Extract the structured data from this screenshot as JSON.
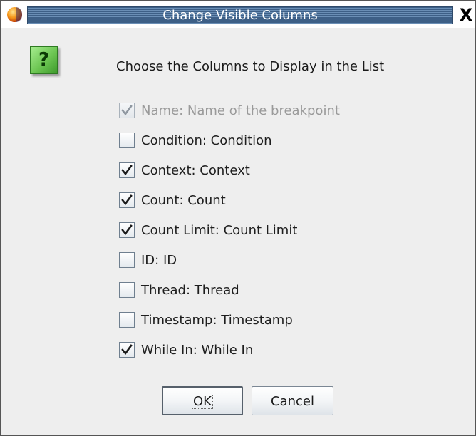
{
  "window": {
    "title": "Change Visible Columns",
    "close_glyph": "X",
    "app_icon": "java-cup-icon"
  },
  "dialog": {
    "help_icon_glyph": "?",
    "prompt": "Choose the Columns to Display in the List",
    "columns": [
      {
        "label": "Name: Name of the breakpoint",
        "checked": true,
        "enabled": false
      },
      {
        "label": "Condition: Condition",
        "checked": false,
        "enabled": true
      },
      {
        "label": "Context: Context",
        "checked": true,
        "enabled": true
      },
      {
        "label": "Count: Count",
        "checked": true,
        "enabled": true
      },
      {
        "label": "Count Limit: Count Limit",
        "checked": true,
        "enabled": true
      },
      {
        "label": "ID: ID",
        "checked": false,
        "enabled": true
      },
      {
        "label": "Thread: Thread",
        "checked": false,
        "enabled": true
      },
      {
        "label": "Timestamp: Timestamp",
        "checked": false,
        "enabled": true
      },
      {
        "label": "While In: While In",
        "checked": true,
        "enabled": true
      }
    ],
    "buttons": {
      "ok_label": "OK",
      "cancel_label": "Cancel"
    }
  },
  "colors": {
    "title_bar": "#46688f",
    "help_icon": "#6cc552",
    "dialog_background": "#eeeeee"
  }
}
